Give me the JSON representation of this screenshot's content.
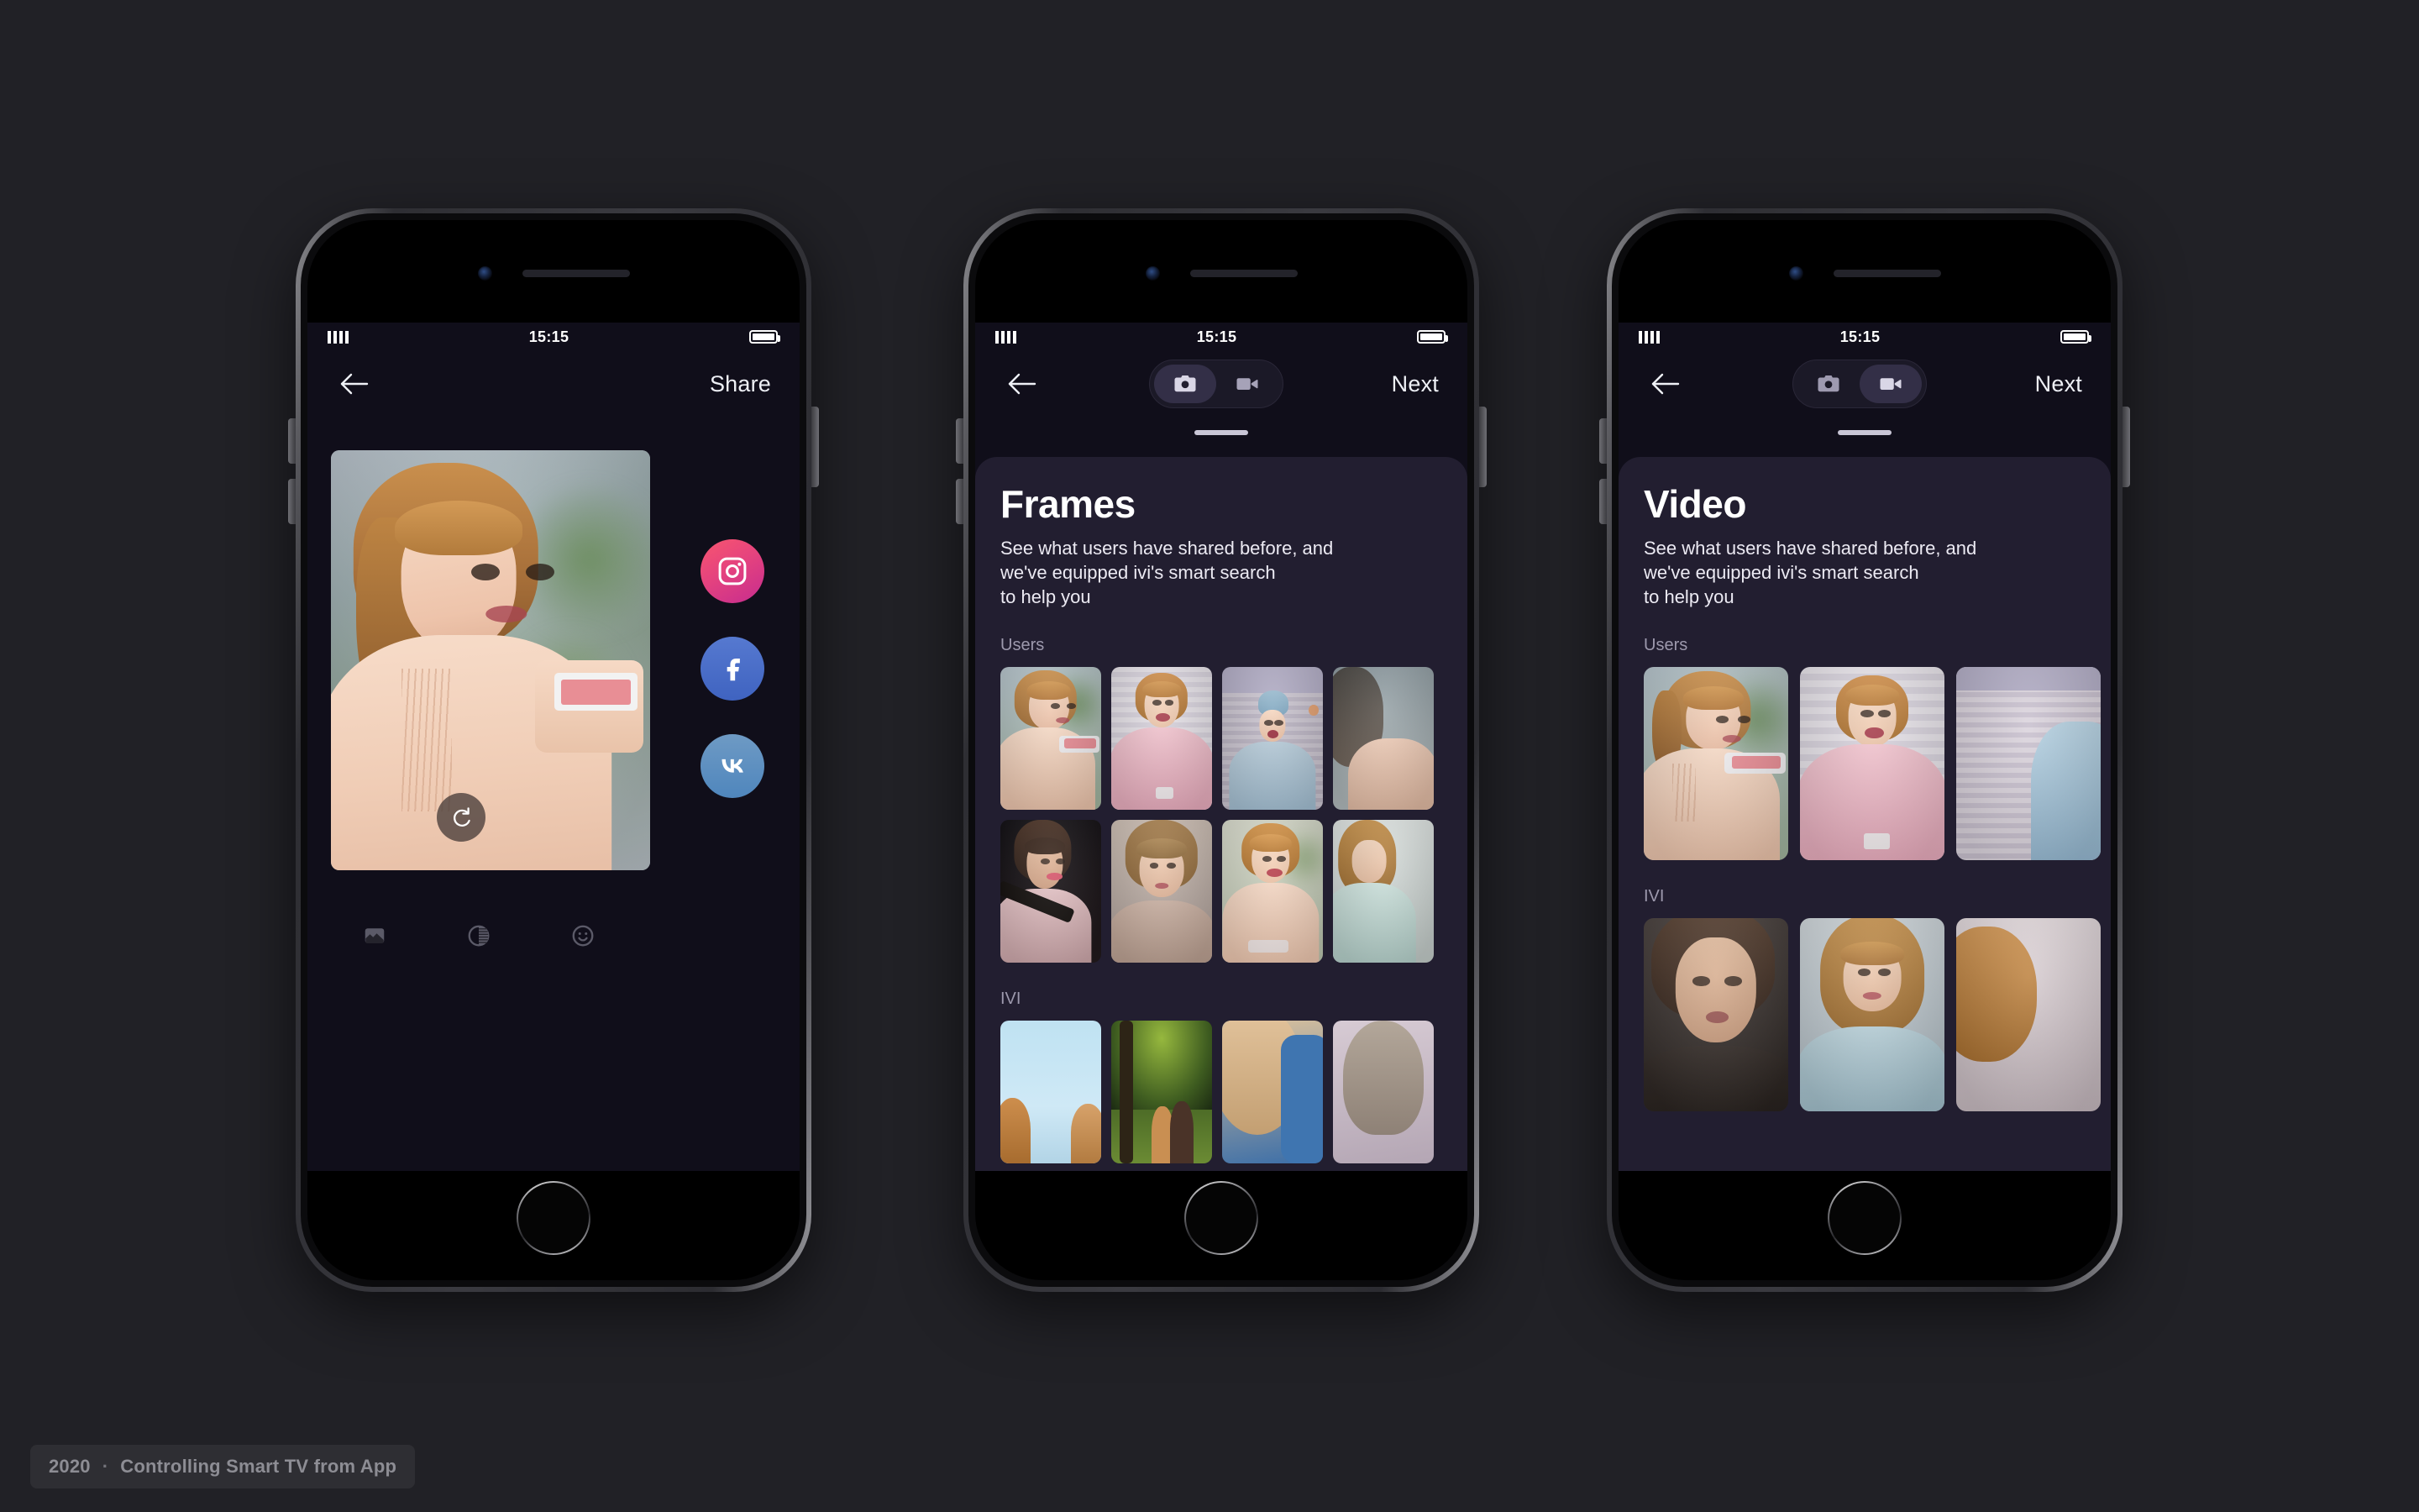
{
  "page": {
    "background_color": "#212126",
    "caption_year": "2020",
    "caption_separator": "·",
    "caption_title": "Controlling Smart TV from App"
  },
  "status_bar": {
    "time": "15:15",
    "signal_icon": "signal-bars-icon",
    "battery_icon": "battery-full-icon"
  },
  "phones": [
    {
      "id": "phone-share",
      "screen": "share",
      "nav": {
        "back_icon": "arrow-left-icon",
        "action_label": "Share"
      },
      "preview": {
        "alt": "woman-photographing-with-pink-phone",
        "redo_icon": "rotate-right-icon"
      },
      "social_buttons": [
        {
          "name": "instagram",
          "label": "Instagram",
          "icon": "instagram-icon",
          "color": "#e5437e"
        },
        {
          "name": "facebook",
          "label": "Facebook",
          "icon": "facebook-icon",
          "color": "#3f63c0"
        },
        {
          "name": "vk",
          "label": "VK",
          "icon": "vk-icon",
          "color": "#4f86bd"
        }
      ],
      "edit_tools": [
        {
          "name": "filters",
          "icon": "image-filter-icon"
        },
        {
          "name": "adjust",
          "icon": "contrast-icon"
        },
        {
          "name": "stickers",
          "icon": "smiley-icon"
        }
      ]
    },
    {
      "id": "phone-frames",
      "screen": "browse",
      "nav": {
        "back_icon": "arrow-left-icon",
        "action_label": "Next",
        "segments": [
          {
            "name": "photo",
            "icon": "camera-icon",
            "active": true
          },
          {
            "name": "video",
            "icon": "video-camera-icon",
            "active": false
          }
        ]
      },
      "sheet": {
        "title": "Frames",
        "description": "See what users have shared before, and we've equipped ivi's smart search to help you",
        "sections": [
          {
            "label": "Users",
            "layout": "grid-3",
            "items": [
              "photo-1",
              "photo-2",
              "photo-3",
              "photo-4",
              "photo-5",
              "photo-6",
              "photo-7",
              "photo-8"
            ]
          },
          {
            "label": "IVI",
            "layout": "grid-3",
            "items": [
              "photo-9",
              "photo-10",
              "photo-11",
              "photo-12"
            ]
          }
        ]
      }
    },
    {
      "id": "phone-video",
      "screen": "browse",
      "nav": {
        "back_icon": "arrow-left-icon",
        "action_label": "Next",
        "segments": [
          {
            "name": "photo",
            "icon": "camera-icon",
            "active": false
          },
          {
            "name": "video",
            "icon": "video-camera-icon",
            "active": true
          }
        ]
      },
      "sheet": {
        "title": "Video",
        "description": "See what users have shared before, and we've equipped ivi's smart search to help you",
        "sections": [
          {
            "label": "Users",
            "layout": "grid-2",
            "items": [
              "video-1",
              "video-2",
              "video-3"
            ]
          },
          {
            "label": "IVI",
            "layout": "grid-2",
            "items": [
              "video-4",
              "video-5",
              "video-6"
            ]
          }
        ]
      }
    }
  ],
  "colors": {
    "sheet_bg": "#221e30",
    "screen_bg": "#100e1a",
    "accent_toggle_active": "#332f47",
    "text_primary": "#ffffff",
    "text_secondary": "#9d99ad"
  }
}
